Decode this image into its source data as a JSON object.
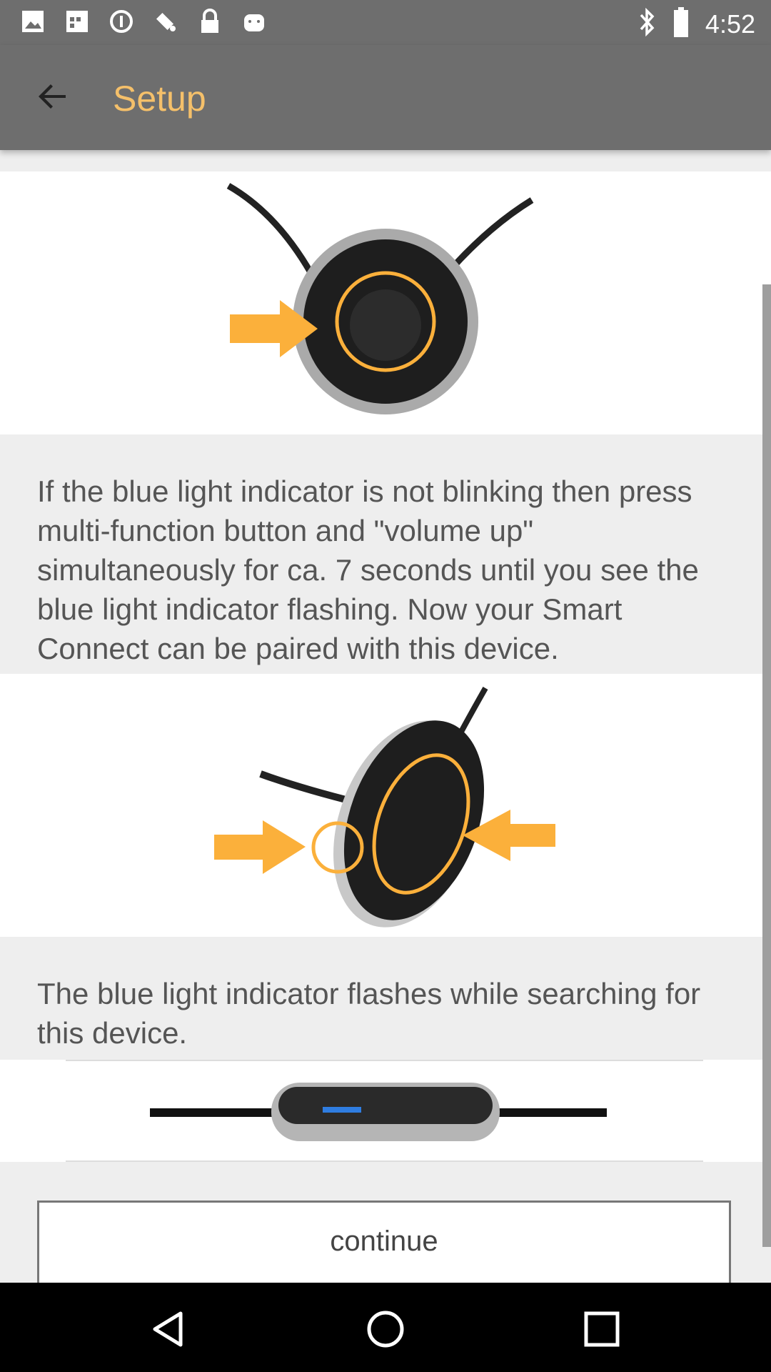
{
  "status_bar": {
    "time": "4:52",
    "left_icons": [
      "photo-icon",
      "shop-icon",
      "circle-icon",
      "satellite-fake-icon",
      "lock-icon",
      "android-icon"
    ],
    "right_icons": [
      "bluetooth-icon",
      "battery-icon"
    ]
  },
  "app_bar": {
    "back_icon": "arrow-back-icon",
    "title": "Setup"
  },
  "steps": [
    {
      "text": "If the blue light indicator is not blinking then press multi-function button and \"volume up\" simultaneously for ca. 7 seconds until you see the blue light indicator flashing. Now your Smart Connect can be paired with this device."
    },
    {
      "text": "The blue light indicator flashes while searching for this device."
    }
  ],
  "continue_label": "continue",
  "nav": {
    "back": "nav-back-icon",
    "home": "nav-home-icon",
    "recents": "nav-recents-icon"
  },
  "colors": {
    "accent": "#f5c06a",
    "bar": "#6e6e6e",
    "arrow": "#fbb03b"
  }
}
